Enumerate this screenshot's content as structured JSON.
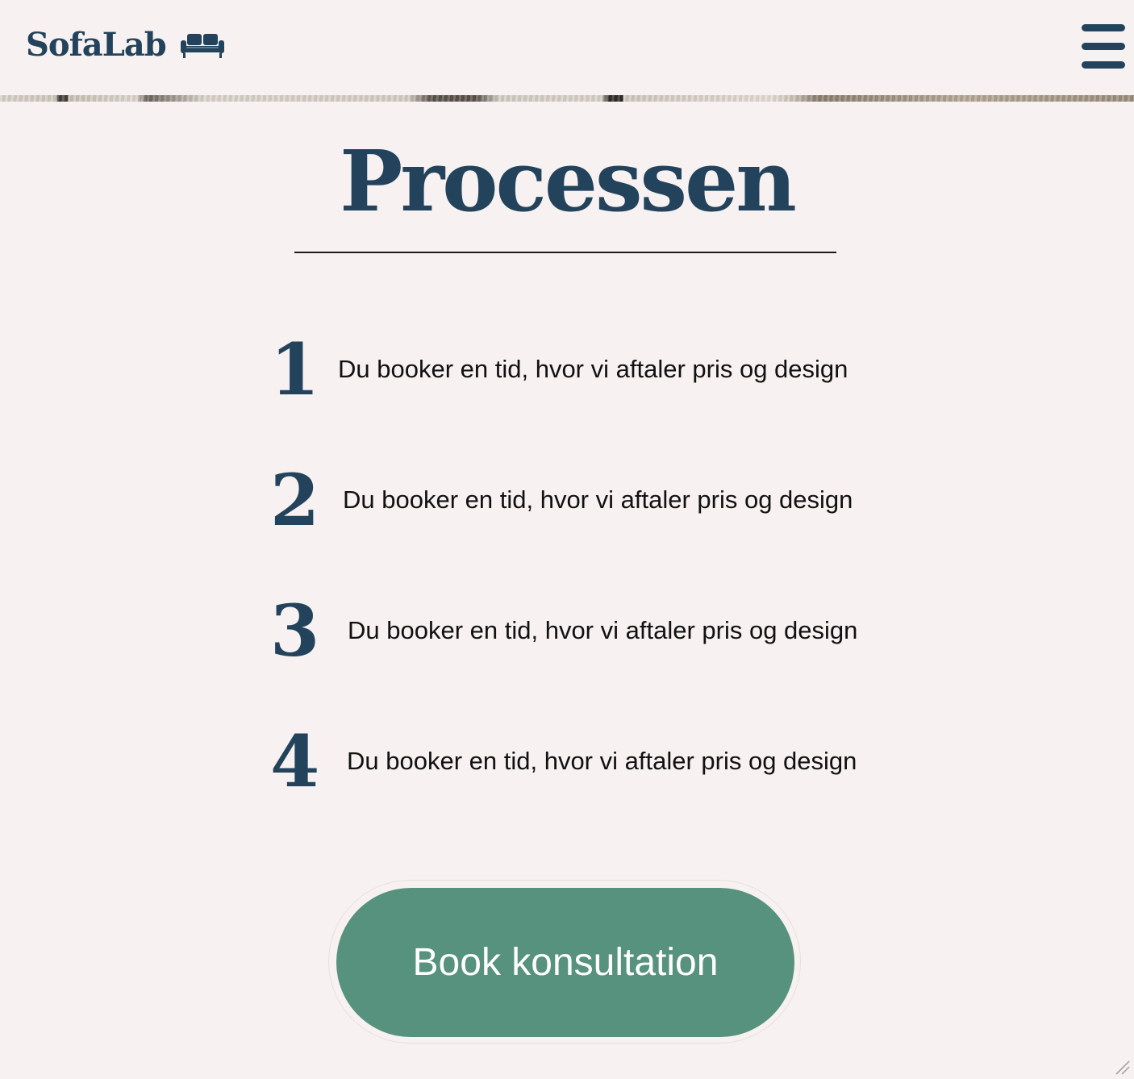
{
  "header": {
    "logo_text": "SofaLab",
    "logo_icon": "sofa-icon",
    "menu_icon": "hamburger-menu-icon"
  },
  "main": {
    "title": "Processen",
    "steps": [
      {
        "number": "1",
        "text": "Du booker en tid, hvor vi aftaler pris og design"
      },
      {
        "number": "2",
        "text": "Du booker en tid, hvor vi aftaler pris og design"
      },
      {
        "number": "3",
        "text": "Du booker en tid, hvor vi aftaler pris og design"
      },
      {
        "number": "4",
        "text": "Du booker en tid, hvor vi aftaler pris og design"
      }
    ],
    "cta_label": "Book konsultation"
  },
  "colors": {
    "background": "#f7f1f1",
    "brand_navy": "#22435b",
    "cta_green": "#56927d",
    "text": "#111111"
  }
}
